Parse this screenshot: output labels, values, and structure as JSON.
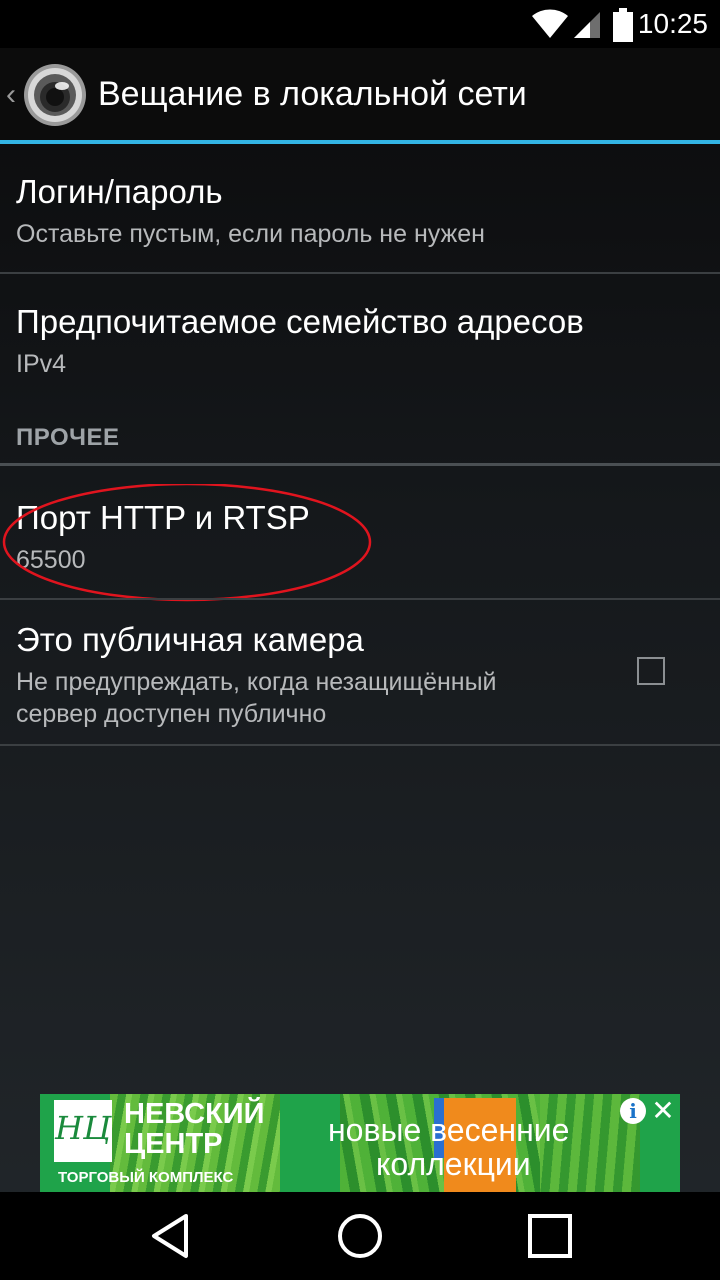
{
  "status_bar": {
    "time": "10:25",
    "icons": [
      "wifi-icon",
      "cell-signal-icon",
      "battery-icon"
    ]
  },
  "action_bar": {
    "title": "Вещание в локальной сети",
    "accent_color": "#33b5e5"
  },
  "preferences": [
    {
      "title": "Логин/пароль",
      "summary": "Оставьте пустым, если пароль не нужен"
    },
    {
      "title": "Предпочитаемое семейство адресов",
      "summary": "IPv4"
    }
  ],
  "category": {
    "label": "ПРОЧЕЕ"
  },
  "other_preferences": [
    {
      "title": "Порт HTTP и RTSP",
      "summary": "65500",
      "highlighted": true,
      "highlight_color": "#e0141e"
    },
    {
      "title": "Это публичная камера",
      "summary_line1": "Не предупреждать, когда незащищённый",
      "summary_line2": "сервер доступен публично",
      "checked": false
    }
  ],
  "ad": {
    "logo_text": "НЦ",
    "brand_line1": "НЕВСКИЙ",
    "brand_line2": "ЦЕНТР",
    "brand_sub": "ТОРГОВЫЙ КОМПЛЕКС",
    "tagline_line1": "новые весенние",
    "tagline_line2": "коллекции",
    "info_label": "i",
    "close_label": "✕",
    "background_color": "#1fa34a"
  },
  "nav_bar": {
    "buttons": [
      "back-icon",
      "home-icon",
      "recents-icon"
    ]
  }
}
